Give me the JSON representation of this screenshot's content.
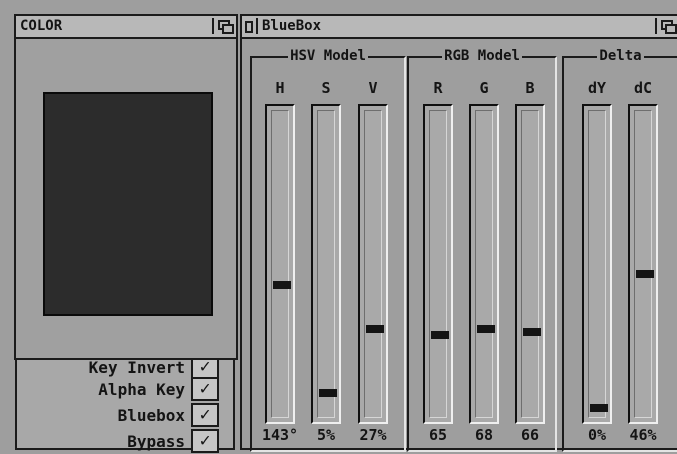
{
  "back_window": {
    "checkboxes": [
      {
        "label": "Key Invert",
        "mark": "✓"
      },
      {
        "label": "Alpha Key",
        "mark": "✓"
      },
      {
        "label": "Bluebox",
        "mark": "✓"
      },
      {
        "label": "Bypass",
        "mark": "✓"
      }
    ]
  },
  "color_window": {
    "title": "COLOR",
    "swatch_color": "#2c2c2c"
  },
  "bluebox_window": {
    "title": "BlueBox",
    "groups": [
      {
        "title": "HSV Model",
        "channels": [
          {
            "label": "H",
            "value": "143°",
            "level": 0.42
          },
          {
            "label": "S",
            "value": "5%",
            "level": 0.05
          },
          {
            "label": "V",
            "value": "27%",
            "level": 0.27
          }
        ]
      },
      {
        "title": "RGB Model",
        "channels": [
          {
            "label": "R",
            "value": "65",
            "level": 0.25
          },
          {
            "label": "G",
            "value": "68",
            "level": 0.27
          },
          {
            "label": "B",
            "value": "66",
            "level": 0.26
          }
        ]
      },
      {
        "title": "Delta",
        "channels": [
          {
            "label": "dY",
            "value": "0%",
            "level": 0.0
          },
          {
            "label": "dC",
            "value": "46%",
            "level": 0.46
          }
        ]
      }
    ]
  }
}
